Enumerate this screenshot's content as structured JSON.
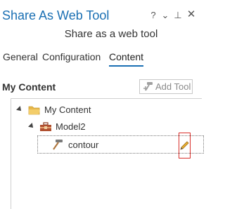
{
  "panel": {
    "title": "Share As Web Tool",
    "subtitle": "Share as a web tool",
    "controls": {
      "help": "?",
      "menu": "⌄",
      "pin": "⊥",
      "close": "✕"
    }
  },
  "tabs": [
    {
      "label": "General",
      "active": false
    },
    {
      "label": "Configuration",
      "active": false
    },
    {
      "label": "Content",
      "active": true
    }
  ],
  "content": {
    "heading": "My Content",
    "add_tool_label": "Add Tool",
    "tree": {
      "root": {
        "label": "My Content",
        "icon": "folder-icon"
      },
      "model": {
        "label": "Model2",
        "icon": "toolbox-icon"
      },
      "tool": {
        "label": "contour",
        "icon": "hammer-icon",
        "action_icon": "pencil-icon"
      }
    }
  },
  "colors": {
    "accent": "#1a6fb3",
    "folder": "#e8b84a",
    "toolbox": "#b05030",
    "highlight_border": "#d9302c"
  }
}
